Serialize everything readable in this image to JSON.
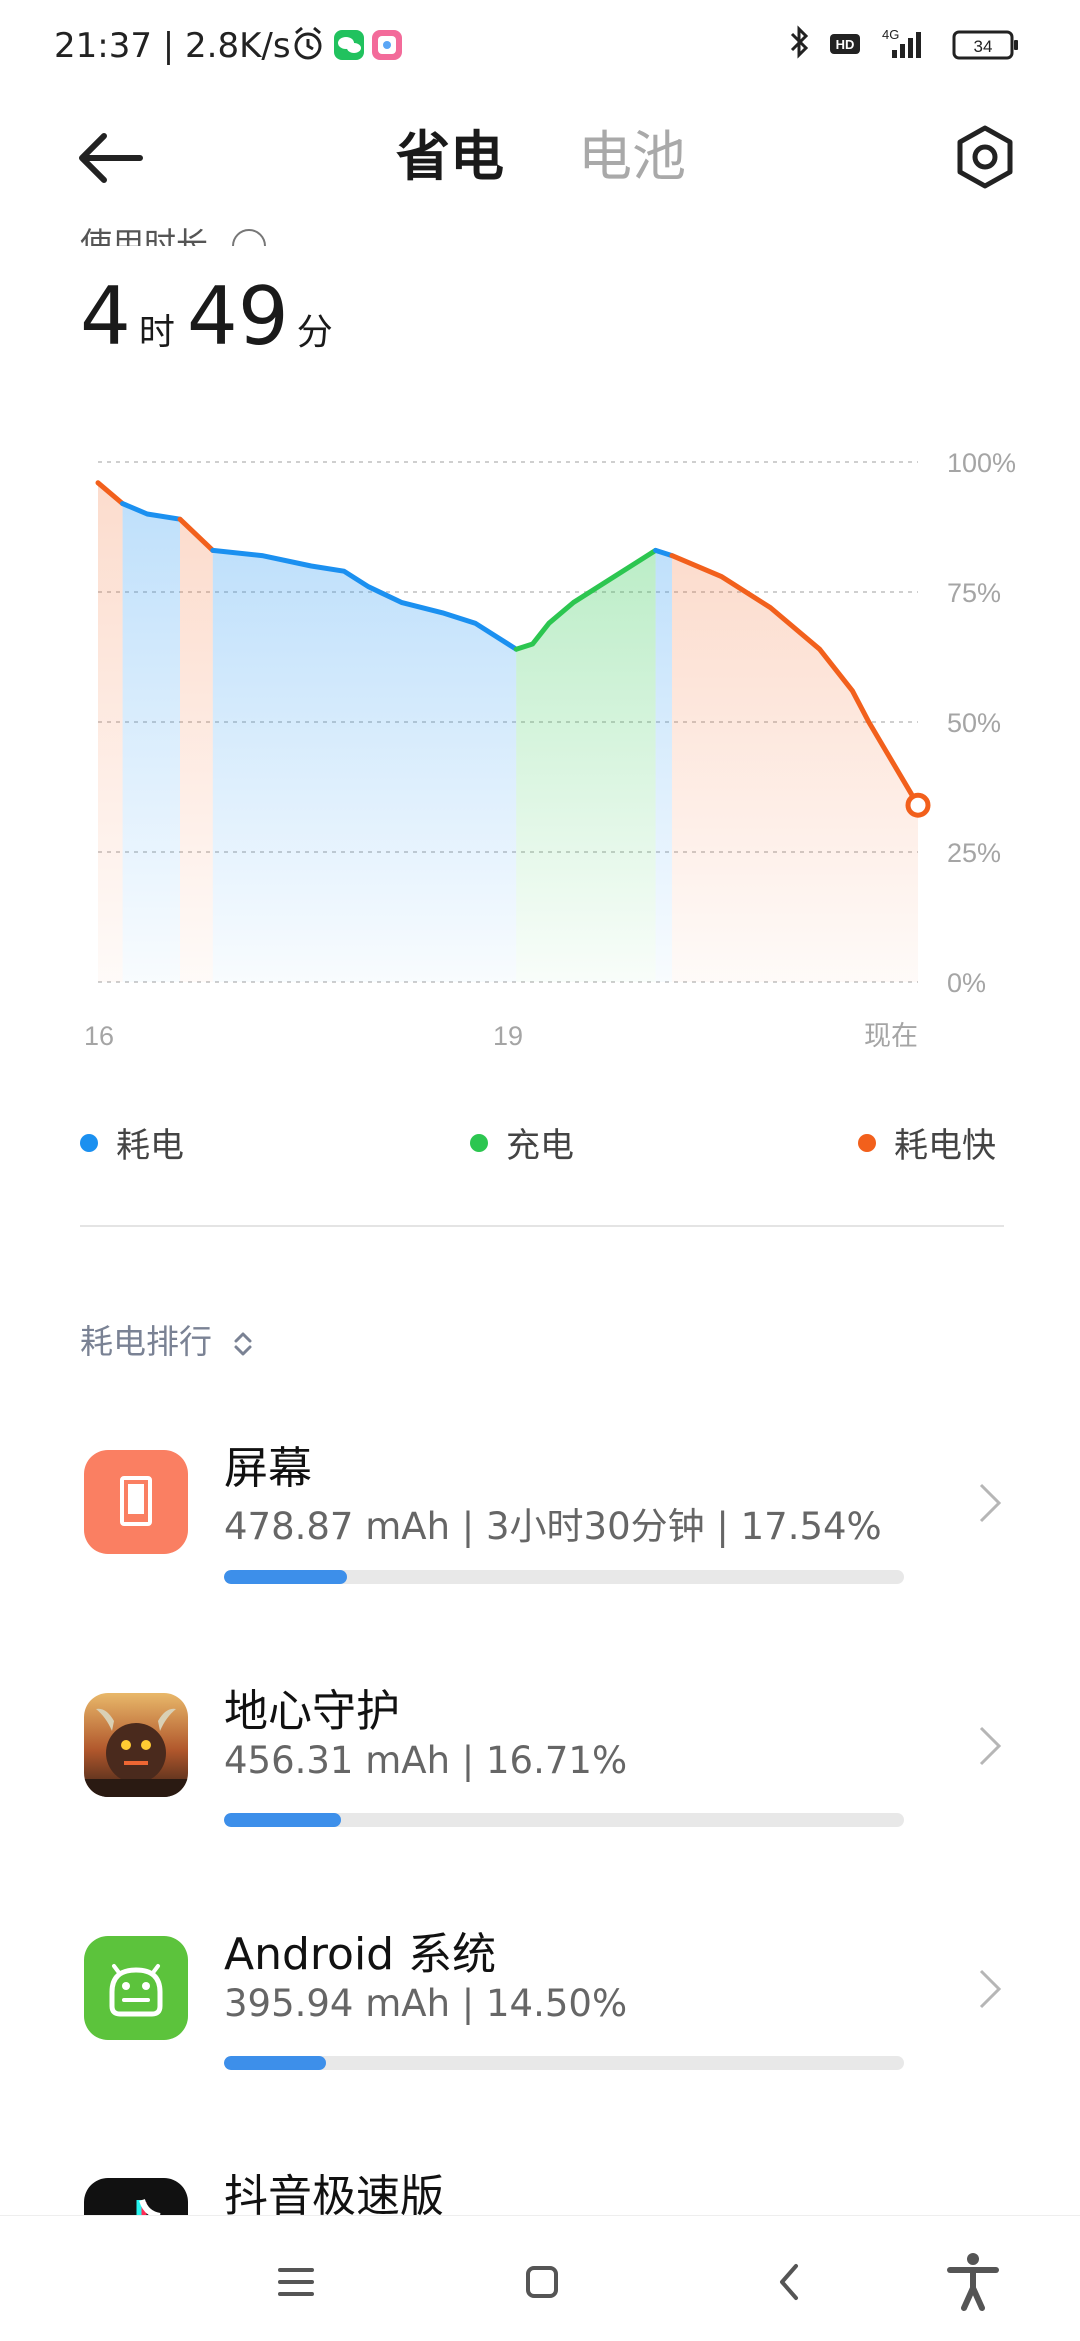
{
  "status_bar": {
    "time_speed": "21:37 | 2.8K/s",
    "battery_level": "34",
    "network": "4G",
    "hd": "HD"
  },
  "header": {
    "tab_power_saving": "省电",
    "tab_battery": "电池"
  },
  "usage": {
    "label": "使用时长",
    "hours": "4",
    "hours_unit": "时",
    "minutes": "49",
    "minutes_unit": "分"
  },
  "chart_data": {
    "type": "area",
    "ylim": [
      0,
      100
    ],
    "y_ticks": [
      "100%",
      "75%",
      "50%",
      "25%",
      "0%"
    ],
    "x_ticks": [
      "16",
      "19",
      "现在"
    ],
    "series": [
      {
        "name": "battery",
        "x": [
          0,
          0.03,
          0.06,
          0.1,
          0.14,
          0.2,
          0.26,
          0.3,
          0.33,
          0.37,
          0.42,
          0.46,
          0.51,
          0.53,
          0.55,
          0.58,
          0.63,
          0.68,
          0.7,
          0.76,
          0.82,
          0.88,
          0.92,
          0.94,
          1.0
        ],
        "y": [
          96,
          92,
          90,
          89,
          83,
          82,
          80,
          79,
          76,
          73,
          71,
          69,
          64,
          65,
          69,
          73,
          78,
          83,
          82,
          78,
          72,
          64,
          56,
          50,
          34
        ],
        "segments": [
          {
            "from": 0,
            "to": 0.03,
            "kind": "fast"
          },
          {
            "from": 0.03,
            "to": 0.1,
            "kind": "drain"
          },
          {
            "from": 0.1,
            "to": 0.14,
            "kind": "fast"
          },
          {
            "from": 0.14,
            "to": 0.51,
            "kind": "drain"
          },
          {
            "from": 0.51,
            "to": 0.68,
            "kind": "charge"
          },
          {
            "from": 0.68,
            "to": 0.7,
            "kind": "drain"
          },
          {
            "from": 0.7,
            "to": 1.0,
            "kind": "fast"
          }
        ]
      }
    ],
    "colors": {
      "drain": "#1b90f0",
      "charge": "#2cc650",
      "fast": "#f2601c"
    }
  },
  "legend": {
    "drain": "耗电",
    "charge": "充电",
    "fast": "耗电快"
  },
  "ranking": {
    "sort_label": "耗电排行",
    "apps": [
      {
        "name": "屏幕",
        "detail": "478.87 mAh | 3小时30分钟 | 17.54%",
        "percent": 17.54,
        "icon": "screen-icon"
      },
      {
        "name": "地心守护",
        "detail": "456.31 mAh | 16.71%",
        "percent": 16.71,
        "icon": "game-icon"
      },
      {
        "name": "Android 系统",
        "detail": "395.94 mAh | 14.50%",
        "percent": 14.5,
        "icon": "android-icon"
      },
      {
        "name": "抖音极速版",
        "detail": "",
        "percent": 0,
        "icon": "douyin-icon"
      }
    ]
  }
}
